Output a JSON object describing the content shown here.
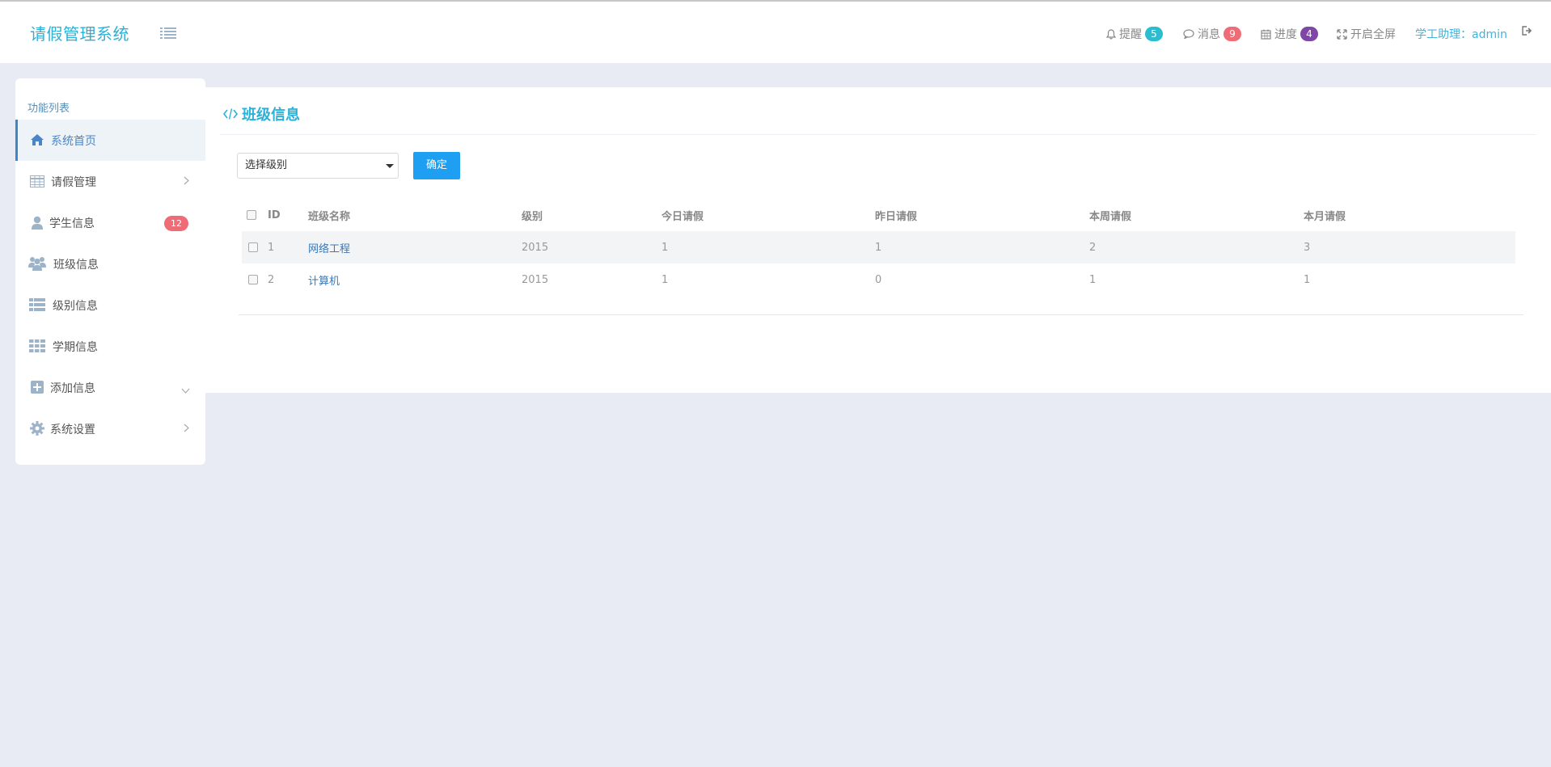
{
  "header": {
    "brand": "请假管理系统",
    "reminder_label": "提醒",
    "reminder_count": "5",
    "message_label": "消息",
    "message_count": "9",
    "progress_label": "进度",
    "progress_count": "4",
    "fullscreen_label": "开启全屏",
    "user_label": "学工助理：admin",
    "colors": {
      "brand": "#2db0d6",
      "reminder_badge": "#2bbccf",
      "message_badge": "#ef6b75",
      "progress_badge": "#7e47a5"
    }
  },
  "sidebar": {
    "title": "功能列表",
    "items": [
      {
        "label": "系统首页",
        "icon": "home-icon",
        "active": true
      },
      {
        "label": "请假管理",
        "icon": "table-icon",
        "has_arrow": "right"
      },
      {
        "label": "学生信息",
        "icon": "user-icon",
        "badge": "12"
      },
      {
        "label": "班级信息",
        "icon": "users-icon"
      },
      {
        "label": "级别信息",
        "icon": "list-icon"
      },
      {
        "label": "学期信息",
        "icon": "grid-icon"
      },
      {
        "label": "添加信息",
        "icon": "plus-square-icon",
        "has_arrow": "down"
      },
      {
        "label": "系统设置",
        "icon": "gear-icon",
        "has_arrow": "right"
      }
    ]
  },
  "main": {
    "title": "班级信息",
    "select": {
      "value": "选择级别"
    },
    "confirm_label": "确定",
    "table": {
      "headers": [
        "ID",
        "班级名称",
        "级别",
        "今日请假",
        "昨日请假",
        "本周请假",
        "本月请假"
      ],
      "rows": [
        {
          "id": "1",
          "name": "网络工程",
          "level": "2015",
          "today": "1",
          "yesterday": "1",
          "week": "2",
          "month": "3"
        },
        {
          "id": "2",
          "name": "计算机",
          "level": "2015",
          "today": "1",
          "yesterday": "0",
          "week": "1",
          "month": "1"
        }
      ]
    }
  }
}
